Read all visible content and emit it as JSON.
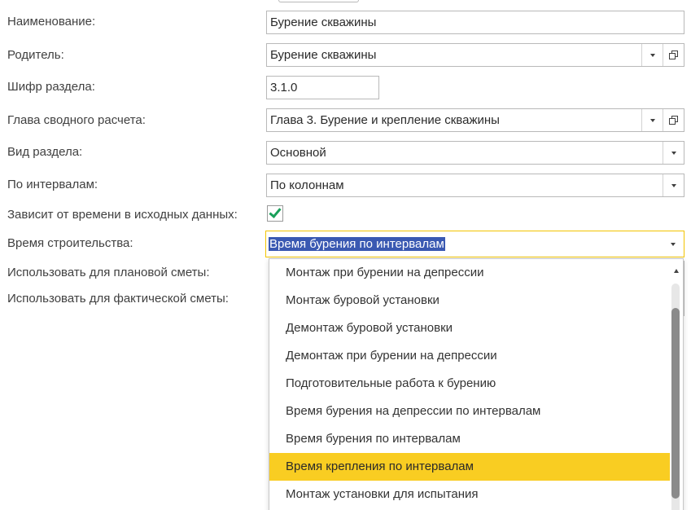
{
  "form": {
    "name": {
      "label": "Наименование:",
      "value": "Бурение скважины"
    },
    "parent": {
      "label": "Родитель:",
      "value": "Бурение скважины"
    },
    "section_code": {
      "label": "Шифр раздела:",
      "value": "3.1.0"
    },
    "summary_chapter": {
      "label": "Глава сводного расчета:",
      "value": "Глава 3. Бурение и крепление скважины"
    },
    "section_type": {
      "label": "Вид раздела:",
      "value": "Основной"
    },
    "by_intervals": {
      "label": "По интервалам:",
      "value": "По колоннам"
    },
    "time_dependent": {
      "label": "Зависит от времени в исходных данных:",
      "checked": true
    },
    "construction_time": {
      "label": "Время строительства:",
      "value": "Время бурения по интервалам"
    },
    "use_planned": {
      "label": "Использовать для плановой сметы:"
    },
    "use_actual": {
      "label": "Использовать для фактической сметы:"
    }
  },
  "dropdown": {
    "items": [
      "Монтаж при бурении на депрессии",
      "Монтаж буровой установки",
      "Демонтаж буровой установки",
      "Демонтаж при бурении на депрессии",
      "Подготовительные работа к бурению",
      "Время бурения на депрессии по интервалам",
      "Время бурения по интервалам",
      "Время крепления по интервалам",
      "Монтаж установки для испытания"
    ],
    "highlighted_index": 7,
    "highlight_color": "#f9cd22"
  },
  "colors": {
    "focus_border": "#f3c400",
    "selection": "#3a59b2",
    "checkmark": "#19a05a"
  }
}
